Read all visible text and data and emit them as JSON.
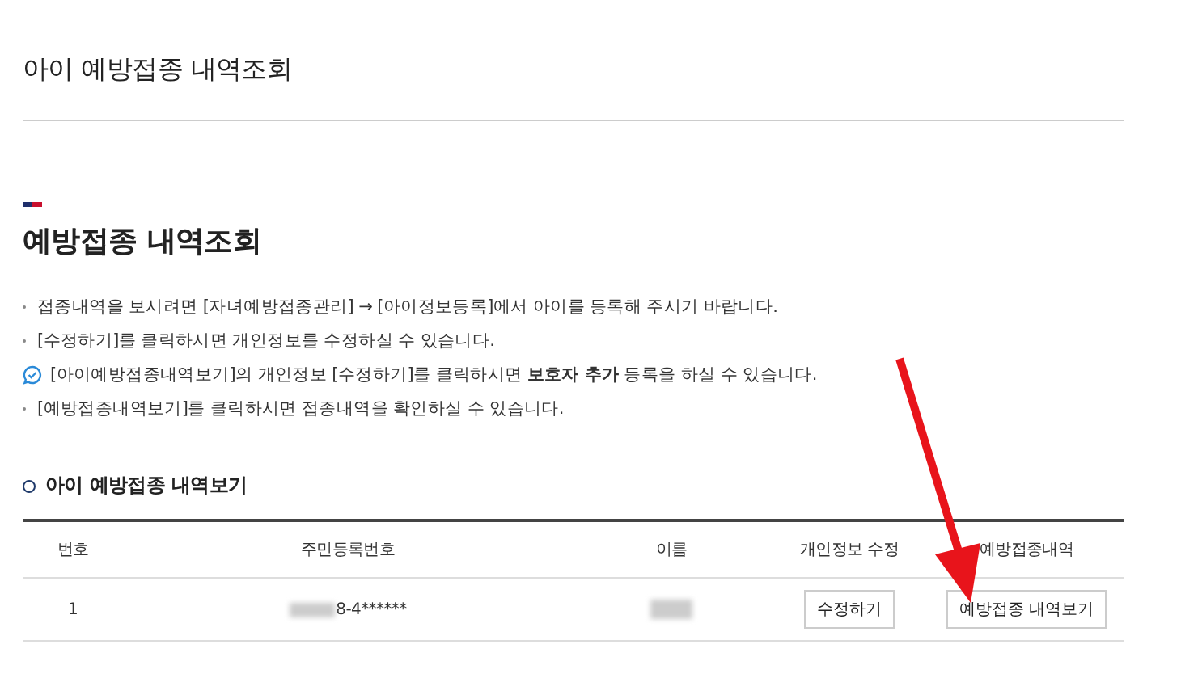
{
  "page_title": "아이 예방접종 내역조회",
  "section": {
    "heading": "예방접종 내역조회",
    "notes": [
      {
        "kind": "bullet",
        "text": "접종내역을 보시려면 [자녀예방접종관리] → [아이정보등록]에서 아이를 등록해 주시기 바랍니다."
      },
      {
        "kind": "bullet",
        "text": "[수정하기]를 클릭하시면 개인정보를 수정하실 수 있습니다."
      },
      {
        "kind": "info",
        "text": "[아이예방접종내역보기]의 개인정보 [수정하기]를 클릭하시면 **보호자 추가** 등록을 하실 수 있습니다."
      },
      {
        "kind": "bullet",
        "text": "[예방접종내역보기]를 클릭하시면 접종내역을 확인하실 수 있습니다."
      }
    ]
  },
  "table": {
    "title": "아이 예방접종 내역보기",
    "columns": [
      "번호",
      "주민등록번호",
      "이름",
      "개인정보 수정",
      "예방접종내역"
    ],
    "rows": [
      {
        "number": "1",
        "resident_number": "8-4******",
        "edit_button": "수정하기",
        "history_button": "예방접종 내역보기"
      }
    ]
  }
}
